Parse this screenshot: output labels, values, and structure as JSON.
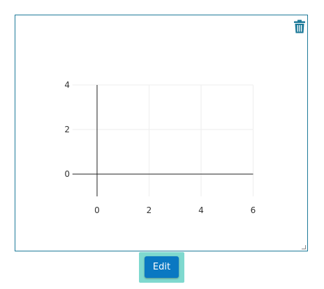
{
  "icons": {
    "trash": "trash-icon",
    "resize": "resize-handle-icon"
  },
  "colors": {
    "border": "#1d7a99",
    "accent": "#0a78c2",
    "focus_ring": "#7fd9cf"
  },
  "edit_button": {
    "label": "Edit"
  },
  "chart_data": {
    "type": "scatter",
    "title": "",
    "xlabel": "",
    "ylabel": "",
    "xlim": [
      -1,
      6
    ],
    "ylim": [
      -1,
      4
    ],
    "x_ticks": [
      0,
      2,
      4,
      6
    ],
    "y_ticks": [
      0,
      2,
      4
    ],
    "x_tick_labels": [
      "0",
      "2",
      "4",
      "6"
    ],
    "y_tick_labels": [
      "0",
      "2",
      "4"
    ],
    "grid": true,
    "series": []
  }
}
